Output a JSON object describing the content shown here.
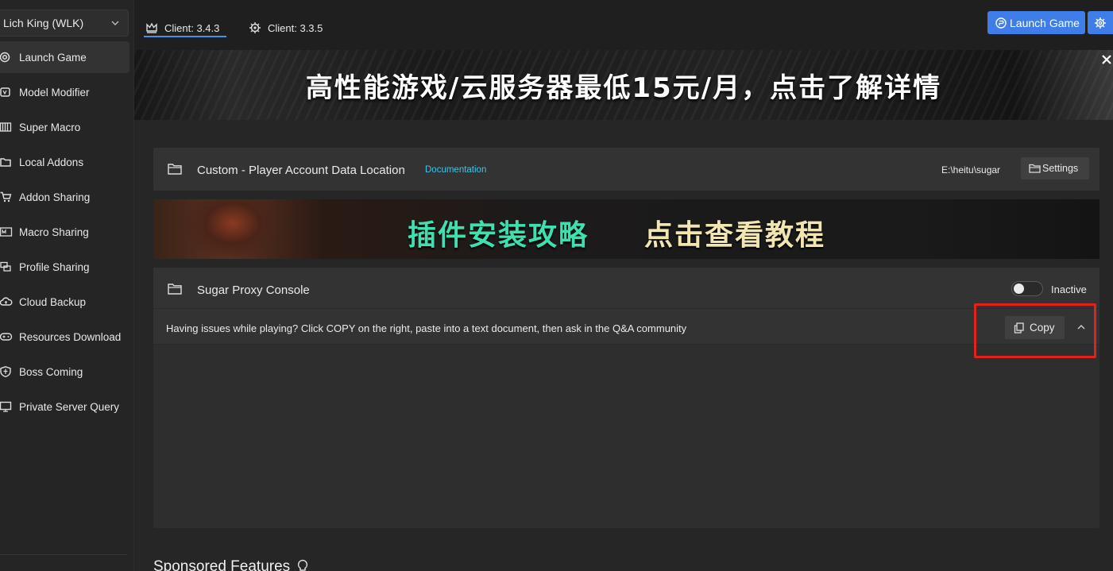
{
  "sidebar": {
    "game_select": "Lich King (WLK)",
    "items": [
      {
        "label": "Launch Game",
        "icon": "launch-icon",
        "active": true
      },
      {
        "label": "Model Modifier",
        "icon": "model-icon"
      },
      {
        "label": "Super Macro",
        "icon": "macro-icon"
      },
      {
        "label": "Local Addons",
        "icon": "folder-icon"
      },
      {
        "label": "Addon Sharing",
        "icon": "cart-icon"
      },
      {
        "label": "Macro Sharing",
        "icon": "macro-share-icon"
      },
      {
        "label": "Profile Sharing",
        "icon": "profile-share-icon"
      },
      {
        "label": "Cloud Backup",
        "icon": "cloud-icon"
      },
      {
        "label": "Resources Download",
        "icon": "gamepad-icon"
      },
      {
        "label": "Boss Coming",
        "icon": "shield-icon"
      },
      {
        "label": "Private Server Query",
        "icon": "monitor-icon"
      }
    ]
  },
  "topbar": {
    "tabs": [
      {
        "label": "Client: 3.4.3",
        "icon": "crown-icon",
        "active": true
      },
      {
        "label": "Client: 3.3.5",
        "icon": "gear-icon"
      }
    ],
    "launch_label": "Launch Game"
  },
  "banner_top": {
    "text": "高性能游戏/云服务器最低15元/月，点击了解详情"
  },
  "account_card": {
    "title": "Custom - Player Account Data Location",
    "doc_link": "Documentation",
    "path": "E:\\heitu\\sugar",
    "settings_label": "Settings"
  },
  "banner_mid": {
    "text_a": "插件安装攻略",
    "text_b": "点击查看教程"
  },
  "proxy_card": {
    "title": "Sugar Proxy Console",
    "status": "Inactive",
    "message": "Having issues while playing? Click COPY on the right, paste into a text document, then ask in the Q&A community",
    "copy_label": "Copy"
  },
  "sponsored": {
    "title": "Sponsored Features"
  },
  "colors": {
    "accent": "#3f7ee8",
    "link": "#3fc3e6",
    "highlight": "#e0221f"
  }
}
